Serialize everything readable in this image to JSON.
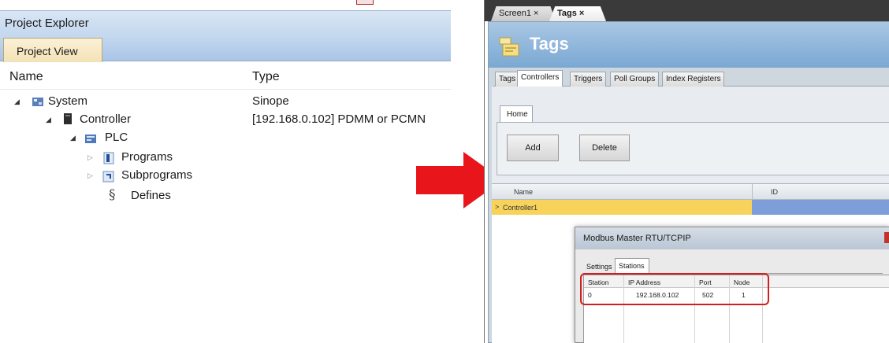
{
  "project_explorer": {
    "title": "Project Explorer",
    "tab": "Project View",
    "columns": {
      "name": "Name",
      "type": "Type"
    },
    "tree": [
      {
        "label": "System",
        "type": "Sinope",
        "icon": "system-icon"
      },
      {
        "label": "Controller",
        "type": "[192.168.0.102] PDMM or PCMN",
        "icon": "controller-icon"
      },
      {
        "label": "PLC",
        "type": "",
        "icon": "plc-icon"
      },
      {
        "label": "Programs",
        "type": "",
        "icon": "programs-icon"
      },
      {
        "label": "Subprograms",
        "type": "",
        "icon": "subprograms-icon"
      },
      {
        "label": "Defines",
        "type": "",
        "icon": "defines-icon"
      }
    ]
  },
  "arrow": {
    "color": "#e8151b"
  },
  "tags_window": {
    "doc_tabs": [
      "Screen1 ×",
      "Tags ×"
    ],
    "header_title": "Tags",
    "tabs": [
      "Tags",
      "Controllers",
      "Triggers",
      "Poll Groups",
      "Index Registers"
    ],
    "ribbon_tab": "Home",
    "buttons": {
      "add": "Add",
      "delete": "Delete"
    },
    "grid": {
      "columns": {
        "name": "Name",
        "id": "ID"
      },
      "row_marker": ">",
      "row_name": "Controller1"
    },
    "modbus_dialog": {
      "title": "Modbus Master RTU/TCPIP",
      "tabs": {
        "settings": "Settings",
        "stations": "Stations"
      },
      "columns": {
        "station": "Station",
        "ip": "IP Address",
        "port": "Port",
        "node": "Node"
      },
      "row": {
        "station": "0",
        "ip": "192.168.0.102",
        "port": "502",
        "node": "1"
      }
    }
  }
}
